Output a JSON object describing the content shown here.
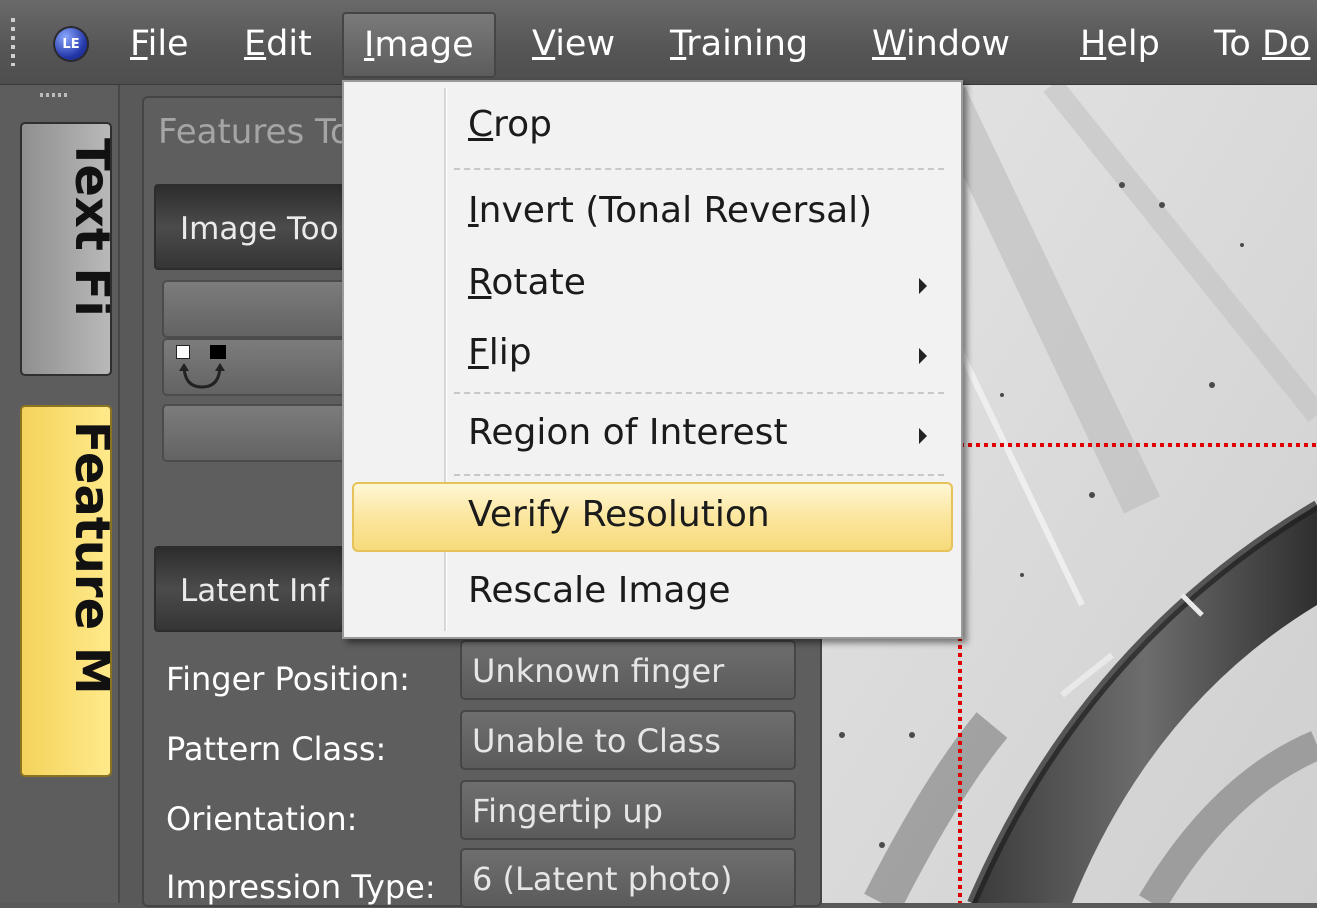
{
  "menubar": {
    "logo_text": "LE",
    "items": [
      {
        "pre": "",
        "u": "F",
        "post": "ile"
      },
      {
        "pre": "",
        "u": "E",
        "post": "dit"
      },
      {
        "pre": "",
        "u": "I",
        "post": "mage"
      },
      {
        "pre": "",
        "u": "V",
        "post": "iew"
      },
      {
        "pre": "",
        "u": "T",
        "post": "raining"
      },
      {
        "pre": "",
        "u": "W",
        "post": "indow"
      },
      {
        "pre": "",
        "u": "H",
        "post": "elp"
      },
      {
        "pre": "To ",
        "u": "Do",
        "post": ""
      }
    ]
  },
  "left_tabs": {
    "tab1": "Text Fi",
    "tab2": "Feature M"
  },
  "panel": {
    "title": "Features To",
    "image_tools_label": "Image Too",
    "latent_info_label": "Latent Inf",
    "fields": [
      {
        "label": "Finger Position:",
        "value": "Unknown finger"
      },
      {
        "label": "Pattern Class:",
        "value": "Unable to Class"
      },
      {
        "label": "Orientation:",
        "value": "Fingertip up"
      },
      {
        "label": "Impression Type:",
        "value": "6 (Latent photo)"
      }
    ]
  },
  "image_menu": {
    "items": [
      {
        "pre": "",
        "u": "C",
        "post": "rop",
        "submenu": false
      },
      {
        "pre": "",
        "u": "I",
        "post": "nvert (Tonal Reversal)",
        "submenu": false
      },
      {
        "pre": "",
        "u": "R",
        "post": "otate",
        "submenu": true
      },
      {
        "pre": "",
        "u": "F",
        "post": "lip",
        "submenu": true
      },
      {
        "pre": "Region of Interest",
        "u": "",
        "post": "",
        "submenu": true
      },
      {
        "pre": "Verify Resolution",
        "u": "",
        "post": "",
        "submenu": false,
        "highlighted": true
      },
      {
        "pre": "Rescale Image",
        "u": "",
        "post": "",
        "submenu": false
      }
    ]
  },
  "colors": {
    "highlight": "#fbe59a",
    "roi_line": "#e00000",
    "feature_tab": "#ffe98a"
  }
}
